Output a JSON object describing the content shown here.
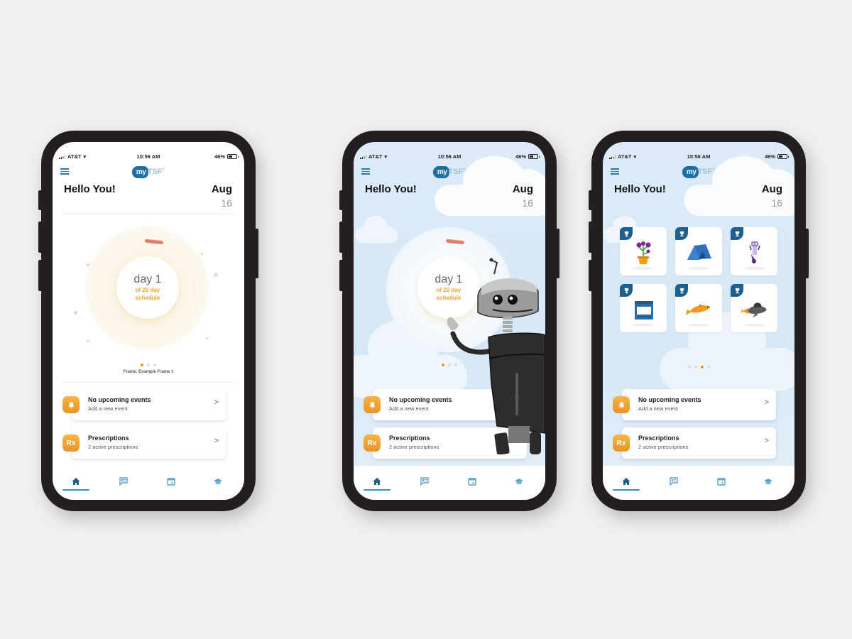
{
  "colors": {
    "background": "#f0f0f2",
    "phone_frame": "#231f20",
    "brand_blue": "#1f6fa5",
    "accent_orange": "#f29a1b",
    "day_subtitle": "#e6a432",
    "sky_blue": "#dcebf7",
    "icon_orange": "#f6b646",
    "badge_corner": "#1e5f8d"
  },
  "status_bar": {
    "carrier": "AT&T",
    "wifi_icon": "wifi-icon",
    "time": "10:56 AM",
    "battery": "46%"
  },
  "header": {
    "menu_icon": "hamburger-icon",
    "logo_my": "my",
    "logo_tsf": "TSF",
    "logo_reg": "®",
    "greeting": "Hello You!",
    "date_month": "Aug",
    "date_day": "16"
  },
  "screens": [
    {
      "id": "screen-1",
      "background": "white",
      "schedule": {
        "day_label": "day 1",
        "subtitle_line1": "of 20 day",
        "subtitle_line2": "schedule"
      },
      "pager": {
        "count": 3,
        "active": 1
      },
      "frame_label": "Frame: Example Frame 1"
    },
    {
      "id": "screen-2",
      "background": "sky",
      "schedule": {
        "day_label": "day 1",
        "subtitle_line1": "of 20 day",
        "subtitle_line2": "schedule"
      },
      "pager": {
        "count": 3,
        "active": 1
      },
      "illustration": "robot"
    },
    {
      "id": "screen-3",
      "background": "sky",
      "badges": [
        {
          "name": "flower-pot",
          "icon": "trophy-icon"
        },
        {
          "name": "tent",
          "icon": "trophy-icon"
        },
        {
          "name": "robot-toy",
          "icon": "trophy-icon"
        },
        {
          "name": "stove",
          "icon": "trophy-icon"
        },
        {
          "name": "fish",
          "icon": "trophy-icon"
        },
        {
          "name": "spaceship",
          "icon": "trophy-icon"
        }
      ],
      "pager": {
        "count": 4,
        "active": 3
      }
    }
  ],
  "cards": {
    "events": {
      "icon": "bell-icon",
      "title": "No upcoming events",
      "subtitle": "Add a new event",
      "chevron": ">"
    },
    "prescriptions": {
      "icon": "rx-icon",
      "icon_text": "Rx",
      "title": "Prescriptions",
      "subtitle": "2 active prescriptions",
      "chevron": ">"
    }
  },
  "tabbar": {
    "tabs": [
      {
        "name": "home",
        "icon": "home-icon",
        "active": true
      },
      {
        "name": "journal",
        "icon": "chat-board-icon",
        "active": false
      },
      {
        "name": "calendar",
        "icon": "calendar-icon",
        "active": false
      },
      {
        "name": "learn",
        "icon": "graduation-cap-icon",
        "active": false
      }
    ]
  }
}
